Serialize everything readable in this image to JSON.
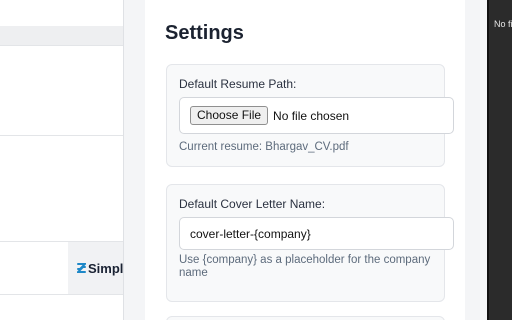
{
  "background_page": {
    "logo_text": "Simpl",
    "logo_color": "#1e88c8"
  },
  "settings": {
    "title": "Settings",
    "resume": {
      "label": "Default Resume Path:",
      "choose_button": "Choose File",
      "no_file_text": "No file chosen",
      "current": "Current resume: Bhargav_CV.pdf"
    },
    "cover_letter": {
      "label": "Default Cover Letter Name:",
      "value": "cover-letter-{company}",
      "helper": "Use {company} as a placeholder for the company name"
    }
  },
  "right_strip": {
    "text": "No fi"
  }
}
